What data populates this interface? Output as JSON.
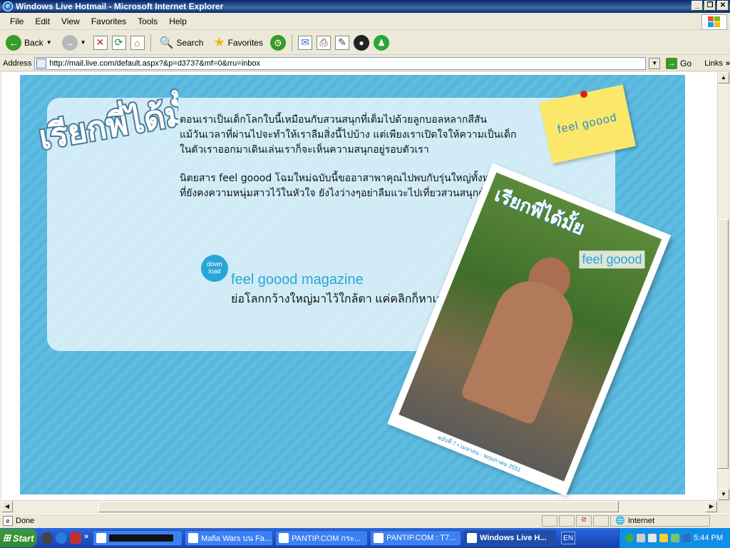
{
  "window": {
    "title": "Windows Live Hotmail - Microsoft Internet Explorer",
    "buttons": [
      "_",
      "❐",
      "✕"
    ]
  },
  "menu": [
    "File",
    "Edit",
    "View",
    "Favorites",
    "Tools",
    "Help"
  ],
  "toolbar": {
    "back_label": "Back",
    "search_label": "Search",
    "favorites_label": "Favorites"
  },
  "address": {
    "label": "Address",
    "url": "http://mail.live.com/default.aspx?&p=d3737&mf=0&rru=inbox",
    "go_label": "Go",
    "links_label": "Links"
  },
  "page": {
    "logo_text": "เรียกพี่ได้มั้ย",
    "paragraph1": [
      "ตอนเราเป็นเด็กโลกใบนี้เหมือนกับสวนสนุกที่เต็มไปด้วยลูกบอลหลากสีสัน",
      "แม้วันเวลาที่ผ่านไปจะทำให้เราลืมสิ่งนี้ไปบ้าง แต่เพียงเราเปิดใจให้ความเป็นเด็ก",
      "ในตัวเราออกมาเดินเล่นเราก็จะเห็นความสนุกอยู่รอบตัวเรา"
    ],
    "paragraph2": [
      "นิตยสาร feel goood โฉมใหม่ฉบับนี้ขออาสาพาคุณไปพบกับรุ่นใหญ่ทั้งหลาย",
      "ที่ยังคงความหนุ่มสาวไว้ในหัวใจ ยังไงว่างๆอย่าลืมแวะไปเที่ยวสวนสนุกด้วยกันนะครับ...."
    ],
    "note_text": "feel goood",
    "download_badge": "down load",
    "magazine_title": "feel goood magazine",
    "magazine_sub": "ย่อโลกกว้างใหญ่มาไว้ใกล้ตา แค่คลิกก็หาเจอ",
    "cover_logo": "เรียกพี่ได้มั้ย",
    "cover_feel": "feel goood",
    "cover_issue": "ฉบับที่ 7 • เมษายน - พฤษภาคม 2551"
  },
  "status": {
    "text": "Done",
    "zone": "Internet"
  },
  "taskbar": {
    "start_label": "Start",
    "tasks": [
      {
        "label": "",
        "active": false
      },
      {
        "label": "Mafia Wars บน Fa...",
        "active": false
      },
      {
        "label": "PANTIP.COM กระ...",
        "active": false
      },
      {
        "label": "PANTIP.COM : T7...",
        "active": false
      },
      {
        "label": "Windows Live H...",
        "active": true
      }
    ],
    "language": "EN",
    "clock": "5:44 PM"
  },
  "colors": {
    "banner": "#5fbde2",
    "accent": "#2aa6d6",
    "title_bar": "#0a246a"
  }
}
